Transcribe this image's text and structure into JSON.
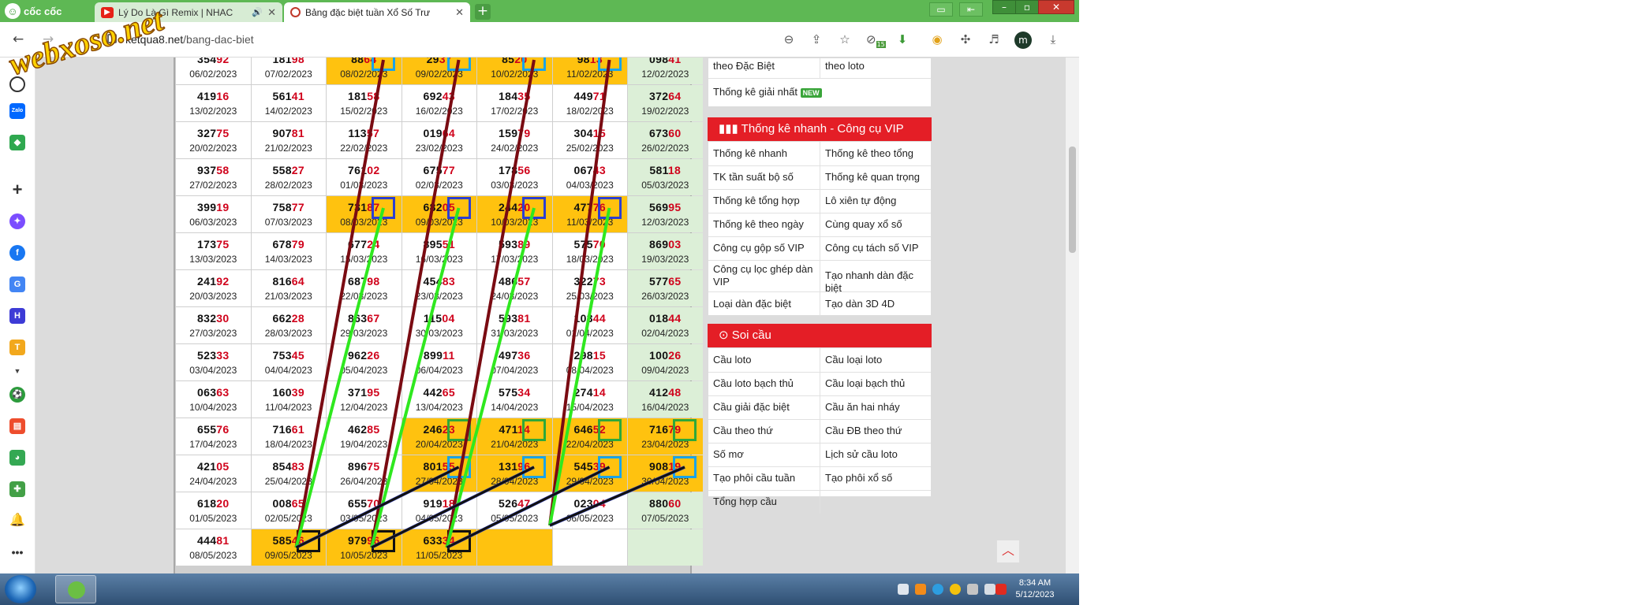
{
  "browser": {
    "brand": "cốc cốc",
    "tabs": [
      {
        "title": "Lý Do Là Gì Remix | NHAC",
        "icon": "youtube-icon"
      },
      {
        "title": "Bảng đặc biệt tuần Xổ Số Trư",
        "icon": "site-icon"
      }
    ],
    "url_host": "ketqua8.net",
    "url_path": "/bang-dac-biet",
    "avatar_letter": "m",
    "extension_badge": "15"
  },
  "watermark": "webxoso.net",
  "table": {
    "rows": [
      [
        [
          "354",
          "92",
          "06/02/2023"
        ],
        [
          "181",
          "98",
          "07/02/2023"
        ],
        [
          "88",
          "64",
          "08/02/2023"
        ],
        [
          "29",
          "37",
          "09/02/2023"
        ],
        [
          "85",
          "20",
          "10/02/2023"
        ],
        [
          "98",
          "13",
          "11/02/2023"
        ],
        [
          "098",
          "41",
          "12/02/2023"
        ]
      ],
      [
        [
          "419",
          "16",
          "13/02/2023"
        ],
        [
          "561",
          "41",
          "14/02/2023"
        ],
        [
          "181",
          "58",
          "15/02/2023"
        ],
        [
          "692",
          "43",
          "16/02/2023"
        ],
        [
          "184",
          "35",
          "17/02/2023"
        ],
        [
          "449",
          "71",
          "18/02/2023"
        ],
        [
          "372",
          "64",
          "19/02/2023"
        ]
      ],
      [
        [
          "327",
          "75",
          "20/02/2023"
        ],
        [
          "907",
          "81",
          "21/02/2023"
        ],
        [
          "113",
          "57",
          "22/02/2023"
        ],
        [
          "019",
          "64",
          "23/02/2023"
        ],
        [
          "159",
          "79",
          "24/02/2023"
        ],
        [
          "304",
          "15",
          "25/02/2023"
        ],
        [
          "673",
          "60",
          "26/02/2023"
        ]
      ],
      [
        [
          "937",
          "58",
          "27/02/2023"
        ],
        [
          "558",
          "27",
          "28/02/2023"
        ],
        [
          "761",
          "02",
          "01/03/2023"
        ],
        [
          "675",
          "77",
          "02/03/2023"
        ],
        [
          "178",
          "56",
          "03/03/2023"
        ],
        [
          "067",
          "43",
          "04/03/2023"
        ],
        [
          "581",
          "18",
          "05/03/2023"
        ]
      ],
      [
        [
          "399",
          "19",
          "06/03/2023"
        ],
        [
          "758",
          "77",
          "07/03/2023"
        ],
        [
          "731",
          "87",
          "08/03/2023"
        ],
        [
          "682",
          "05",
          "09/03/2023"
        ],
        [
          "244",
          "20",
          "10/03/2023"
        ],
        [
          "477",
          "76",
          "11/03/2023"
        ],
        [
          "569",
          "95",
          "12/03/2023"
        ]
      ],
      [
        [
          "173",
          "75",
          "13/03/2023"
        ],
        [
          "678",
          "79",
          "14/03/2023"
        ],
        [
          "677",
          "24",
          "15/03/2023"
        ],
        [
          "895",
          "51",
          "16/03/2023"
        ],
        [
          "593",
          "89",
          "17/03/2023"
        ],
        [
          "575",
          "70",
          "18/03/2023"
        ],
        [
          "869",
          "03",
          "19/03/2023"
        ]
      ],
      [
        [
          "241",
          "92",
          "20/03/2023"
        ],
        [
          "816",
          "64",
          "21/03/2023"
        ],
        [
          "687",
          "98",
          "22/03/2023"
        ],
        [
          "454",
          "83",
          "23/03/2023"
        ],
        [
          "486",
          "57",
          "24/03/2023"
        ],
        [
          "322",
          "73",
          "25/03/2023"
        ],
        [
          "577",
          "65",
          "26/03/2023"
        ]
      ],
      [
        [
          "832",
          "30",
          "27/03/2023"
        ],
        [
          "662",
          "28",
          "28/03/2023"
        ],
        [
          "863",
          "67",
          "29/03/2023"
        ],
        [
          "115",
          "04",
          "30/03/2023"
        ],
        [
          "593",
          "81",
          "31/03/2023"
        ],
        [
          "103",
          "44",
          "01/04/2023"
        ],
        [
          "018",
          "44",
          "02/04/2023"
        ]
      ],
      [
        [
          "523",
          "33",
          "03/04/2023"
        ],
        [
          "753",
          "45",
          "04/04/2023"
        ],
        [
          "962",
          "26",
          "05/04/2023"
        ],
        [
          "899",
          "11",
          "06/04/2023"
        ],
        [
          "497",
          "36",
          "07/04/2023"
        ],
        [
          "298",
          "15",
          "08/04/2023"
        ],
        [
          "100",
          "26",
          "09/04/2023"
        ]
      ],
      [
        [
          "063",
          "63",
          "10/04/2023"
        ],
        [
          "160",
          "39",
          "11/04/2023"
        ],
        [
          "371",
          "95",
          "12/04/2023"
        ],
        [
          "442",
          "65",
          "13/04/2023"
        ],
        [
          "575",
          "34",
          "14/04/2023"
        ],
        [
          "274",
          "14",
          "15/04/2023"
        ],
        [
          "412",
          "48",
          "16/04/2023"
        ]
      ],
      [
        [
          "655",
          "76",
          "17/04/2023"
        ],
        [
          "716",
          "61",
          "18/04/2023"
        ],
        [
          "462",
          "85",
          "19/04/2023"
        ],
        [
          "246",
          "23",
          "20/04/2023"
        ],
        [
          "471",
          "14",
          "21/04/2023"
        ],
        [
          "646",
          "52",
          "22/04/2023"
        ],
        [
          "716",
          "79",
          "23/04/2023"
        ]
      ],
      [
        [
          "421",
          "05",
          "24/04/2023"
        ],
        [
          "854",
          "83",
          "25/04/2023"
        ],
        [
          "896",
          "75",
          "26/04/2023"
        ],
        [
          "801",
          "55",
          "27/04/2023"
        ],
        [
          "131",
          "96",
          "28/04/2023"
        ],
        [
          "545",
          "39",
          "29/04/2023"
        ],
        [
          "908",
          "19",
          "30/04/2023"
        ]
      ],
      [
        [
          "618",
          "20",
          "01/05/2023"
        ],
        [
          "008",
          "65",
          "02/05/2023"
        ],
        [
          "655",
          "70",
          "03/05/2023"
        ],
        [
          "919",
          "18",
          "04/05/2023"
        ],
        [
          "526",
          "47",
          "05/05/2023"
        ],
        [
          "023",
          "04",
          "06/05/2023"
        ],
        [
          "880",
          "60",
          "07/05/2023"
        ]
      ],
      [
        [
          "444",
          "81",
          "08/05/2023"
        ],
        [
          "585",
          "46",
          "09/05/2023"
        ],
        [
          "979",
          "96",
          "10/05/2023"
        ],
        [
          "633",
          "34",
          "11/05/2023"
        ],
        [
          "",
          "",
          ""
        ],
        [
          "",
          "",
          ""
        ],
        [
          "",
          "",
          ""
        ]
      ]
    ]
  },
  "right_panel": {
    "top_links": [
      [
        "theo Đặc Biệt",
        "theo loto"
      ],
      [
        "Thống kê giải nhất",
        ""
      ]
    ],
    "new_badge": "NEW",
    "section1_title": "Thống kê nhanh - Công cụ VIP",
    "section1_links": [
      [
        "Thống kê nhanh",
        "Thống kê theo tổng"
      ],
      [
        "TK tần suất bộ số",
        "Thống kê quan trọng"
      ],
      [
        "Thống kê tổng hợp",
        "Lô xiên tự động"
      ],
      [
        "Thống kê theo ngày",
        "Cùng quay xổ số"
      ],
      [
        "Công cụ gộp số VIP",
        "Công cụ tách số VIP"
      ],
      [
        "Công cụ lọc ghép dàn VIP",
        "Tạo nhanh dàn đặc biệt"
      ],
      [
        "Loại dàn đặc biệt",
        "Tạo dàn 3D 4D"
      ]
    ],
    "section2_title": "Soi cầu",
    "section2_links": [
      [
        "Cầu loto",
        "Cầu loại loto"
      ],
      [
        "Cầu loto bạch thủ",
        "Cầu loại bạch thủ"
      ],
      [
        "Cầu giải đặc biệt",
        "Cầu ăn hai nháy"
      ],
      [
        "Cầu theo thứ",
        "Cầu ĐB theo thứ"
      ],
      [
        "Số mơ",
        "Lịch sử cầu loto"
      ],
      [
        "Tạo phôi cầu tuần",
        "Tạo phôi xổ số"
      ],
      [
        "Tổng hợp cầu",
        ""
      ]
    ]
  },
  "taskbar": {
    "time": "8:34 AM",
    "date": "5/12/2023"
  }
}
